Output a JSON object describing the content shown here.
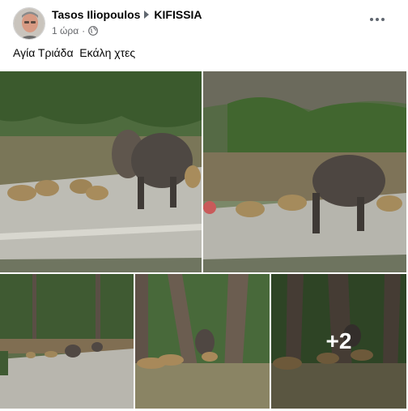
{
  "post": {
    "author": "Tasos Iliopoulos",
    "group": "KIFISSIA",
    "time": "1 ώρα",
    "separator": "·",
    "privacy_icon": "globe-icon",
    "more_icon": "more-options-icon",
    "text": "Αγία Τριάδα  Εκάλη χτες"
  },
  "photos": {
    "more_count": "+2"
  },
  "colors": {
    "text_primary": "#050505",
    "text_secondary": "#65676b",
    "icon_gray": "#606770"
  }
}
